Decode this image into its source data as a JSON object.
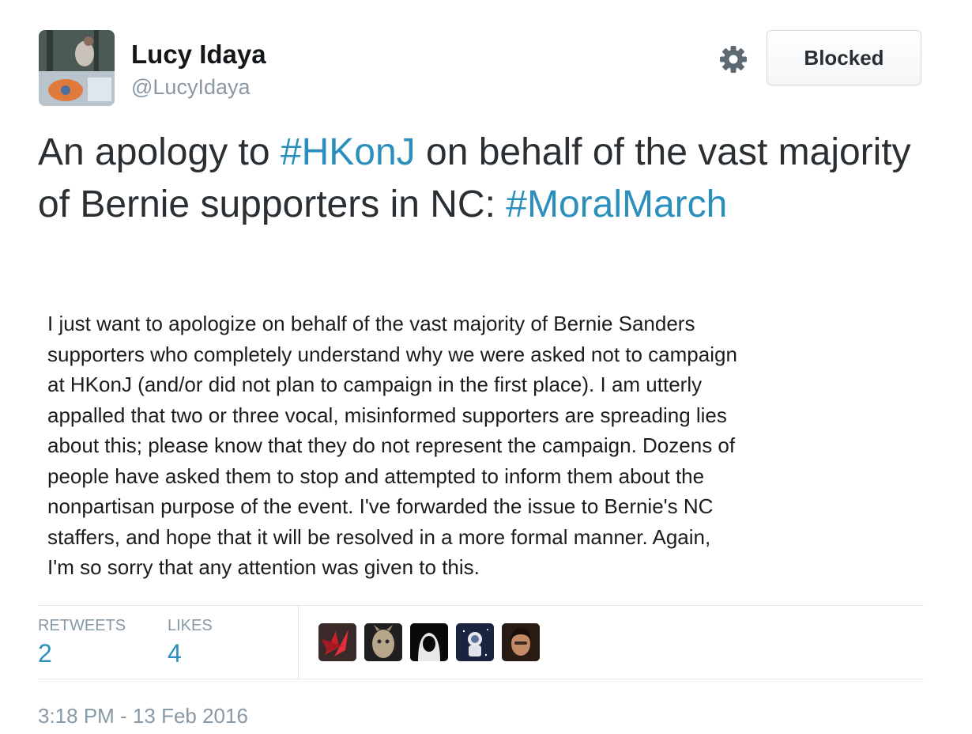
{
  "user": {
    "display_name": "Lucy Idaya",
    "handle": "@LucyIdaya",
    "avatar_icon": "profile-photo"
  },
  "actions": {
    "settings_icon": "gear-icon",
    "blocked_label": "Blocked"
  },
  "tweet": {
    "text_before": "An apology to ",
    "hashtag_1": "#HKonJ",
    "text_middle": " on behalf of the vast majority of Bernie supporters in NC: ",
    "hashtag_2": "#MoralMarch"
  },
  "attached_image_text": [
    "I just want to apologize on behalf of the vast majority of Bernie Sanders",
    "supporters who completely understand why we were asked not to campaign",
    "at HKonJ (and/or did not plan to campaign in the first place). I am utterly",
    "appalled that two or three vocal, misinformed supporters are spreading lies",
    "about this; please know that they do not represent the campaign. Dozens of",
    "people have asked them to stop and attempted to inform them about the",
    "nonpartisan purpose of the event. I've forwarded the issue to Bernie's NC",
    "staffers, and hope that it will be resolved in a more formal manner. Again,",
    "I'm so sorry that any attention was given to this."
  ],
  "stats": {
    "retweets_label": "RETWEETS",
    "retweets_count": "2",
    "likes_label": "LIKES",
    "likes_count": "4"
  },
  "likers": [
    {
      "icon": "red-plant-avatar"
    },
    {
      "icon": "sculpture-avatar"
    },
    {
      "icon": "hooded-figure-avatar"
    },
    {
      "icon": "astronaut-avatar"
    },
    {
      "icon": "woman-portrait-avatar"
    }
  ],
  "timestamp": "3:18 PM - 13 Feb 2016",
  "colors": {
    "link": "#2a8fbd",
    "secondary_text": "#8899a6",
    "primary_text": "#292f33"
  }
}
